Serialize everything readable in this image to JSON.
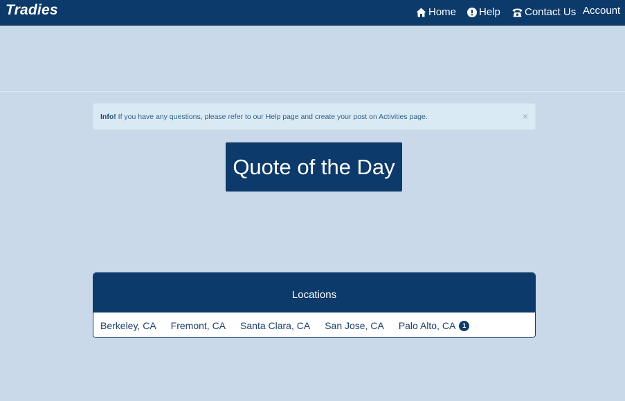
{
  "brand": "Tradies",
  "nav": {
    "home": "Home",
    "help": "Help",
    "contact": "Contact Us",
    "account": "Account"
  },
  "alert": {
    "label": "Info!",
    "message": " If you have any questions, please refer to our Help page and create your post on Activities page.",
    "close": "×"
  },
  "quote_title": "Quote of the Day",
  "locations": {
    "title": "Locations",
    "items": [
      {
        "name": "Berkeley, CA"
      },
      {
        "name": "Fremont, CA"
      },
      {
        "name": "Santa Clara, CA"
      },
      {
        "name": "San Jose, CA"
      },
      {
        "name": "Palo Alto, CA",
        "badge": "1"
      }
    ]
  },
  "colors": {
    "primary": "#0c3a6a",
    "background": "#c9d9ea",
    "alert_bg": "#d9eaf5"
  },
  "icons": [
    "home-icon",
    "exclamation-circle-icon",
    "phone-icon",
    "caret-down-icon",
    "close-icon"
  ]
}
